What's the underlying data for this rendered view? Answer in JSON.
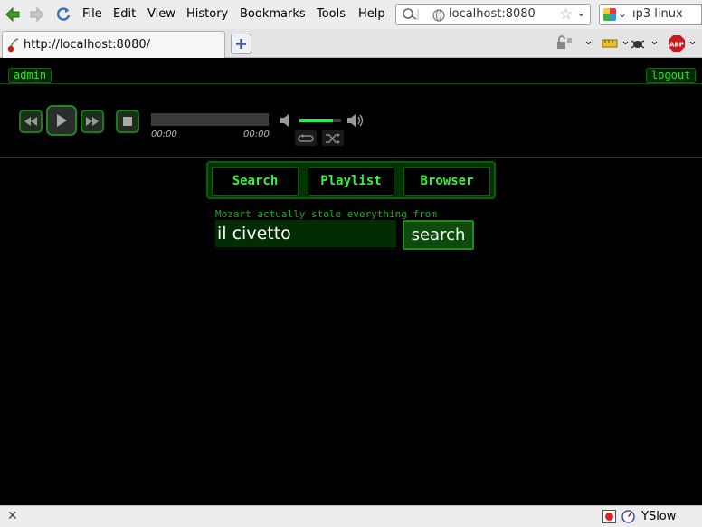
{
  "browser": {
    "menu": [
      {
        "key": "file",
        "label": "File"
      },
      {
        "key": "edit",
        "label": "Edit"
      },
      {
        "key": "view",
        "label": "View"
      },
      {
        "key": "history",
        "label": "History"
      },
      {
        "key": "bookmarks",
        "label": "Bookmarks"
      },
      {
        "key": "tools",
        "label": "Tools"
      },
      {
        "key": "help",
        "label": "Help"
      }
    ],
    "url": "localhost:8080",
    "search_text": "ıp3 linux",
    "tab_title": "http://localhost:8080/",
    "status_addon": "YSlow"
  },
  "app": {
    "user_label": "admin",
    "logout_label": "logout",
    "player": {
      "elapsed": "00:00",
      "duration": "00:00",
      "progress": 0,
      "volume": 0.8
    },
    "nav_tabs": [
      {
        "key": "search",
        "label": "Search"
      },
      {
        "key": "playlist",
        "label": "Playlist"
      },
      {
        "key": "browser",
        "label": "Browser"
      }
    ],
    "quote": "Mozart actually stole everything from",
    "search_value": "il civetto",
    "search_button": "search"
  },
  "colors": {
    "accent_green": "#33dd33",
    "page_bg": "#000000"
  }
}
